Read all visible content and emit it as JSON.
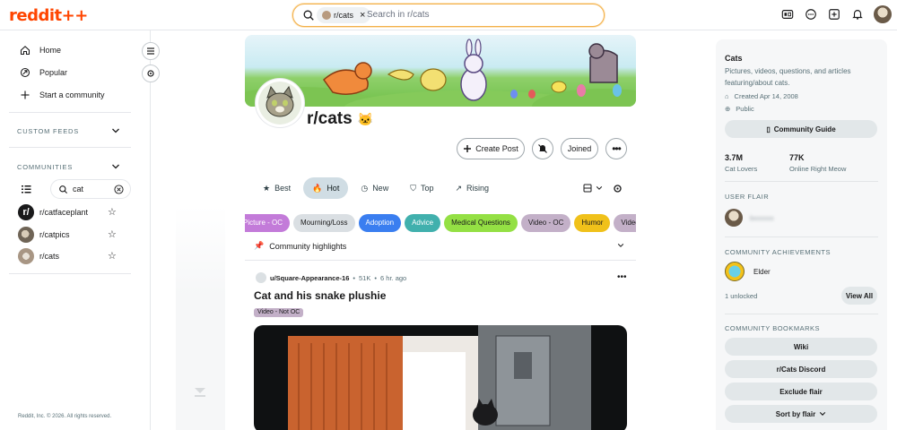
{
  "header": {
    "logo": "reddit++",
    "search_chip": "r/cats",
    "search_placeholder": "Search in r/cats",
    "icons": [
      "ads-icon",
      "chat-icon",
      "create-post-icon",
      "notification-bell-icon",
      "user-avatar"
    ]
  },
  "left_sidebar": {
    "nav": [
      {
        "label": "Home",
        "icon": "home-icon"
      },
      {
        "label": "Popular",
        "icon": "popular-icon"
      },
      {
        "label": "Start a community",
        "icon": "plus-icon"
      }
    ],
    "custom_feeds_title": "CUSTOM FEEDS",
    "communities_title": "COMMUNITIES",
    "filter_value": "cat",
    "communities": [
      {
        "name": "r/catfaceplant",
        "color": "#1a1a1b"
      },
      {
        "name": "r/catpics",
        "color": "#8a7a6a"
      },
      {
        "name": "r/cats",
        "color": "#b8a898"
      }
    ],
    "copyright": "Reddit, Inc. © 2026. All rights reserved."
  },
  "community": {
    "title": "r/cats",
    "create_post": "Create Post",
    "joined": "Joined",
    "sort_tabs": [
      "Best",
      "Hot",
      "New",
      "Top",
      "Rising"
    ],
    "active_sort": "Hot",
    "flairs": [
      {
        "label": "Picture - OC",
        "bg": "#c37bd9",
        "fg": "#ffffff"
      },
      {
        "label": "Mourning/Loss",
        "bg": "#dadfe3",
        "fg": "#1a1a1b"
      },
      {
        "label": "Adoption",
        "bg": "#3a7ef0",
        "fg": "#ffffff"
      },
      {
        "label": "Advice",
        "bg": "#41b0ad",
        "fg": "#ffffff"
      },
      {
        "label": "Medical Questions",
        "bg": "#94e044",
        "fg": "#1a1a1b"
      },
      {
        "label": "Video - OC",
        "bg": "#c3b0c8",
        "fg": "#1a1a1b"
      },
      {
        "label": "Humor",
        "bg": "#f0c11a",
        "fg": "#1a1a1b"
      },
      {
        "label": "Video - Not OC",
        "bg": "#c3b0c8",
        "fg": "#1a1a1b"
      }
    ],
    "highlights_label": "Community highlights"
  },
  "post": {
    "author": "u/Square-Appearance-16",
    "score": "51K",
    "age": "6 hr. ago",
    "title": "Cat and his snake plushie",
    "flair": "Video - Not OC"
  },
  "right_sidebar": {
    "name": "Cats",
    "description": "Pictures, videos, questions, and articles featuring/about cats.",
    "created": "Created Apr 14, 2008",
    "visibility": "Public",
    "guide_button": "Community Guide",
    "members_count": "3.7M",
    "members_label": "Cat Lovers",
    "online_count": "77K",
    "online_label": "Online Right Meow",
    "user_flair_title": "USER FLAIR",
    "user_flair_name": "bxxxxxx",
    "achievements_title": "COMMUNITY ACHIEVEMENTS",
    "achievement_name": "Elder",
    "unlocked": "1 unlocked",
    "view_all": "View All",
    "bookmarks_title": "COMMUNITY BOOKMARKS",
    "bookmarks": [
      "Wiki",
      "r/Cats Discord",
      "Exclude flair",
      "Sort by flair"
    ]
  }
}
